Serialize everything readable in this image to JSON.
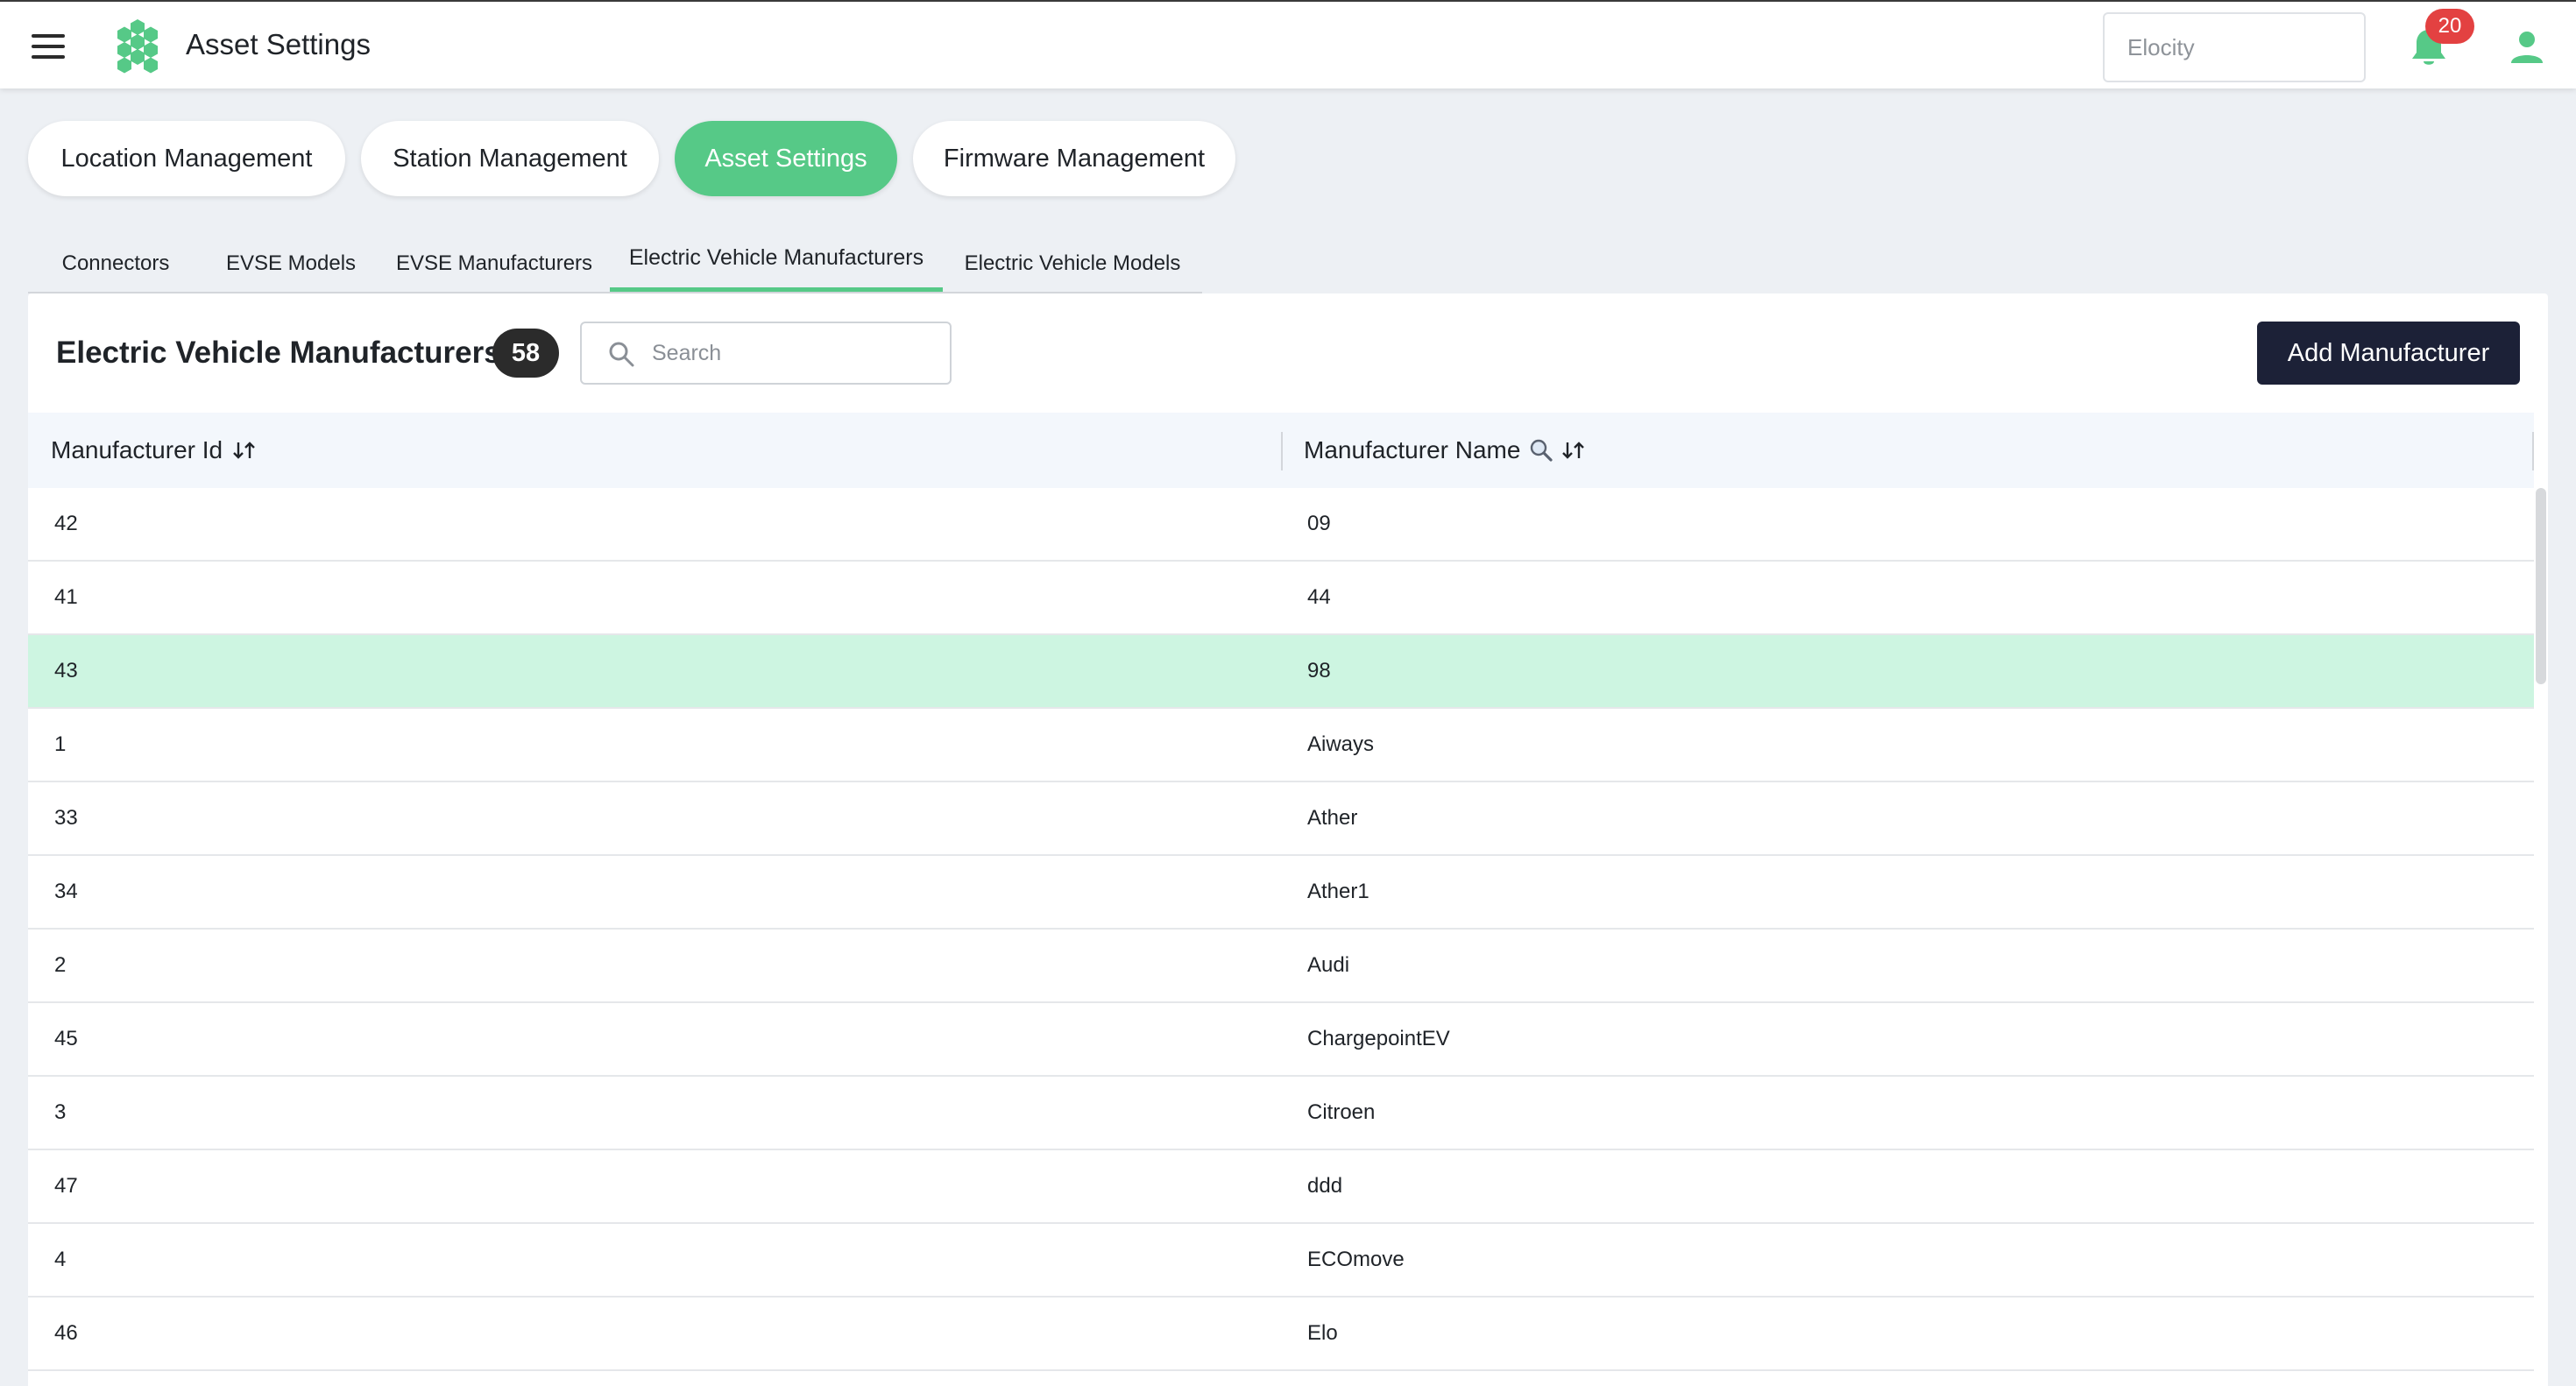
{
  "header": {
    "title": "Asset Settings",
    "org_placeholder": "Elocity",
    "notification_count": "20"
  },
  "pills": [
    {
      "label": "Location Management",
      "active": false
    },
    {
      "label": "Station Management",
      "active": false
    },
    {
      "label": "Asset Settings",
      "active": true
    },
    {
      "label": "Firmware Management",
      "active": false
    }
  ],
  "subtabs": [
    {
      "label": "Connectors",
      "active": false
    },
    {
      "label": "EVSE Models",
      "active": false
    },
    {
      "label": "EVSE Manufacturers",
      "active": false
    },
    {
      "label": "Electric Vehicle Manufacturers",
      "active": true
    },
    {
      "label": "Electric Vehicle Models",
      "active": false
    }
  ],
  "card": {
    "title": "Electric Vehicle Manufacturers",
    "count": "58",
    "search_placeholder": "Search",
    "add_button": "Add Manufacturer"
  },
  "table": {
    "columns": [
      "Manufacturer Id",
      "Manufacturer Name"
    ],
    "rows": [
      {
        "id": "42",
        "name": "09",
        "highlight": false
      },
      {
        "id": "41",
        "name": "44",
        "highlight": false
      },
      {
        "id": "43",
        "name": "98",
        "highlight": true
      },
      {
        "id": "1",
        "name": "Aiways",
        "highlight": false
      },
      {
        "id": "33",
        "name": "Ather",
        "highlight": false
      },
      {
        "id": "34",
        "name": "Ather1",
        "highlight": false
      },
      {
        "id": "2",
        "name": "Audi",
        "highlight": false
      },
      {
        "id": "45",
        "name": "ChargepointEV",
        "highlight": false
      },
      {
        "id": "3",
        "name": "Citroen",
        "highlight": false
      },
      {
        "id": "47",
        "name": "ddd",
        "highlight": false
      },
      {
        "id": "4",
        "name": "ECOmove",
        "highlight": false
      },
      {
        "id": "46",
        "name": "Elo",
        "highlight": false
      },
      {
        "id": "",
        "name": "",
        "highlight": false
      }
    ]
  },
  "colors": {
    "accent": "#56c987",
    "highlight_row": "#cdf5e1",
    "primary_button": "#1c2137",
    "badge": "#e34141"
  },
  "icons": [
    "menu-icon",
    "hexagon-logo-icon",
    "bell-icon",
    "user-icon",
    "search-icon",
    "sort-icon",
    "filter-search-icon"
  ]
}
